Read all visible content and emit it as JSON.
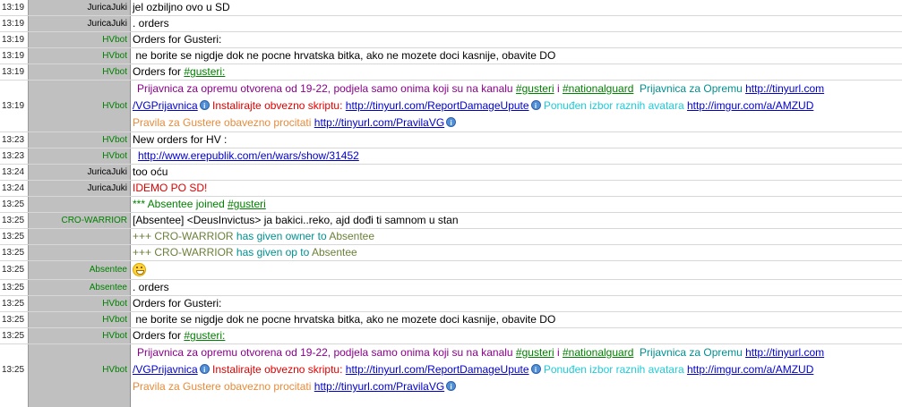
{
  "rows": [
    {
      "time": "13:19",
      "nick": "JuricaJuki",
      "text": "jel ozbiljno ovo u SD"
    },
    {
      "time": "13:19",
      "nick": "JuricaJuki",
      "text": ". orders"
    },
    {
      "time": "13:19",
      "nick": "HVbot",
      "text": "Orders for Gusteri:"
    },
    {
      "time": "13:19",
      "nick": "HVbot",
      "text": " ne borite se nigdje dok ne pocne hrvatska bitka, ako ne mozete doci kasnije, obavite DO"
    },
    {
      "time": "13:19",
      "nick": "HVbot",
      "prefix": "Orders for ",
      "channel": "#gusteri:"
    },
    {
      "time": "13:19",
      "nick": "HVbot"
    },
    {
      "time": "13:23",
      "nick": "HVbot",
      "text": "New orders for HV :"
    },
    {
      "time": "13:23",
      "nick": "HVbot",
      "link": "http://www.erepublik.com/en/wars/show/31452"
    },
    {
      "time": "13:24",
      "nick": "JuricaJuki",
      "text": "too oću"
    },
    {
      "time": "13:24",
      "nick": "JuricaJuki",
      "text": "IDEMO PO SD!"
    },
    {
      "time": "13:25",
      "nick": "",
      "prefix": "*** Absentee joined ",
      "channel": "#gusteri"
    },
    {
      "time": "13:25",
      "nick": "CRO-WARRIOR",
      "text": "[Absentee] <DeusInvictus> ja bakici..reko, ajd dođi ti samnom u stan"
    },
    {
      "time": "13:25",
      "nick": "",
      "p1": "+++ CRO-WARRIOR",
      "p2": " has given owner to ",
      "p3": "Absentee"
    },
    {
      "time": "13:25",
      "nick": "",
      "p1": "+++ CRO-WARRIOR",
      "p2": " has given op to ",
      "p3": "Absentee"
    },
    {
      "time": "13:25",
      "nick": "Absentee"
    },
    {
      "time": "13:25",
      "nick": "Absentee",
      "text": ". orders"
    },
    {
      "time": "13:25",
      "nick": "HVbot",
      "text": "Orders for Gusteri:"
    },
    {
      "time": "13:25",
      "nick": "HVbot",
      "text": " ne borite se nigdje dok ne pocne hrvatska bitka, ako ne mozete doci kasnije, obavite DO"
    },
    {
      "time": "13:25",
      "nick": "HVbot",
      "prefix": "Orders for ",
      "channel": "#gusteri:"
    },
    {
      "time": "13:25",
      "nick": "HVbot"
    }
  ],
  "block": {
    "l1a": "Prijavnica za opremu otvorena od 19-22, podjela samo onima koji su na kanalu ",
    "ch1": "#gusteri",
    "l1b": " i ",
    "ch2": "#nationalguard",
    "l1c": "  Prijavnica za Opremu ",
    "url1": "http://tinyurl.com",
    "url1b": "/VGPrijavnica",
    "l2a": " Instalirajte obvezno skriptu: ",
    "url2": "http://tinyurl.com/ReportDamageUpute",
    "l2b": " Ponuđen izbor raznih avatara ",
    "url3": "http://imgur.com/a/AMZUD",
    "l3a": "Pravila za Gustere obavezno procitati ",
    "url4": "http://tinyurl.com/PravilaVG"
  },
  "colors": {
    "nick_green": "#008000",
    "nick_bg": "#c0c0c0"
  }
}
